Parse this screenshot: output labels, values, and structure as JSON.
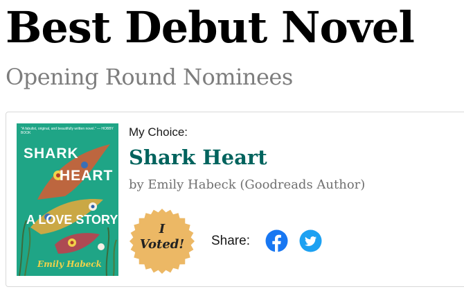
{
  "header": {
    "title": "Best Debut Novel",
    "subtitle": "Opening Round Nominees"
  },
  "vote": {
    "choice_label": "My Choice:",
    "book": {
      "title": "Shark Heart",
      "author_line": "by Emily Habeck (Goodreads Author)",
      "cover": {
        "quote": "\"A fabulist, original, and beautifully written novel.\" — HOBBY BOOK",
        "title_line1": "SHARK",
        "title_line2": "HEART",
        "subtitle_line": "A LOVE STORY",
        "author": "Emily Habeck"
      }
    },
    "badge": {
      "line1": "I",
      "line2": "Voted!",
      "color": "#ecb865"
    },
    "share_label": "Share:",
    "share_icons": [
      {
        "name": "facebook-icon",
        "color": "#1877f2"
      },
      {
        "name": "twitter-icon",
        "color": "#1da1f2"
      }
    ]
  },
  "colors": {
    "title": "#000000",
    "subtitle": "#7d7d7d",
    "book_title": "#00635d",
    "author": "#707070",
    "cover_background": "#1fa586"
  }
}
